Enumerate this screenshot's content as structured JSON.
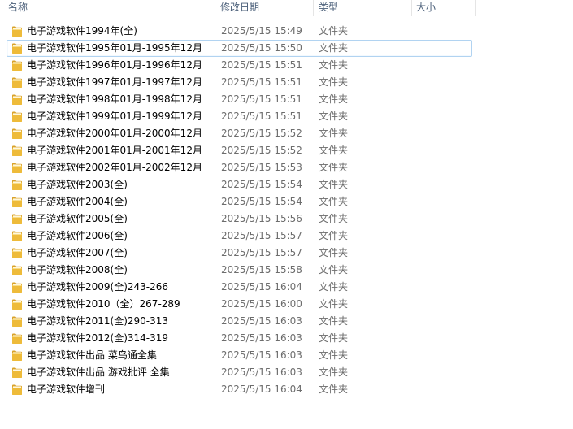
{
  "columns": {
    "name": "名称",
    "date": "修改日期",
    "type": "类型",
    "size": "大小"
  },
  "colors": {
    "header_text": "#4c607a",
    "meta_text": "#6d6d6d",
    "selection_border": "#b1d3f1",
    "folder": "#e8b53a"
  },
  "selected_index": 1,
  "files": [
    {
      "icon": "folder-icon",
      "name": "电子游戏软件1994年(全)",
      "date": "2025/5/15 15:49",
      "type": "文件夹"
    },
    {
      "icon": "folder-icon",
      "name": "电子游戏软件1995年01月-1995年12月",
      "date": "2025/5/15 15:50",
      "type": "文件夹"
    },
    {
      "icon": "folder-icon",
      "name": "电子游戏软件1996年01月-1996年12月",
      "date": "2025/5/15 15:51",
      "type": "文件夹"
    },
    {
      "icon": "folder-icon",
      "name": "电子游戏软件1997年01月-1997年12月",
      "date": "2025/5/15 15:51",
      "type": "文件夹"
    },
    {
      "icon": "folder-icon",
      "name": "电子游戏软件1998年01月-1998年12月",
      "date": "2025/5/15 15:51",
      "type": "文件夹"
    },
    {
      "icon": "folder-icon",
      "name": "电子游戏软件1999年01月-1999年12月",
      "date": "2025/5/15 15:51",
      "type": "文件夹"
    },
    {
      "icon": "folder-icon",
      "name": "电子游戏软件2000年01月-2000年12月",
      "date": "2025/5/15 15:52",
      "type": "文件夹"
    },
    {
      "icon": "folder-icon",
      "name": "电子游戏软件2001年01月-2001年12月",
      "date": "2025/5/15 15:52",
      "type": "文件夹"
    },
    {
      "icon": "folder-icon",
      "name": "电子游戏软件2002年01月-2002年12月",
      "date": "2025/5/15 15:53",
      "type": "文件夹"
    },
    {
      "icon": "folder-icon",
      "name": "电子游戏软件2003(全)",
      "date": "2025/5/15 15:54",
      "type": "文件夹"
    },
    {
      "icon": "folder-icon",
      "name": "电子游戏软件2004(全)",
      "date": "2025/5/15 15:54",
      "type": "文件夹"
    },
    {
      "icon": "folder-icon",
      "name": "电子游戏软件2005(全)",
      "date": "2025/5/15 15:56",
      "type": "文件夹"
    },
    {
      "icon": "folder-icon",
      "name": "电子游戏软件2006(全)",
      "date": "2025/5/15 15:57",
      "type": "文件夹"
    },
    {
      "icon": "folder-icon",
      "name": "电子游戏软件2007(全)",
      "date": "2025/5/15 15:57",
      "type": "文件夹"
    },
    {
      "icon": "folder-icon",
      "name": "电子游戏软件2008(全)",
      "date": "2025/5/15 15:58",
      "type": "文件夹"
    },
    {
      "icon": "folder-icon",
      "name": "电子游戏软件2009(全)243-266",
      "date": "2025/5/15 16:04",
      "type": "文件夹"
    },
    {
      "icon": "folder-icon",
      "name": "电子游戏软件2010（全）267-289",
      "date": "2025/5/15 16:00",
      "type": "文件夹"
    },
    {
      "icon": "folder-icon",
      "name": "电子游戏软件2011(全)290-313",
      "date": "2025/5/15 16:03",
      "type": "文件夹"
    },
    {
      "icon": "folder-icon",
      "name": "电子游戏软件2012(全)314-319",
      "date": "2025/5/15 16:03",
      "type": "文件夹"
    },
    {
      "icon": "folder-icon",
      "name": "电子游戏软件出品 菜鸟通全集",
      "date": "2025/5/15 16:03",
      "type": "文件夹"
    },
    {
      "icon": "folder-icon",
      "name": "电子游戏软件出品 游戏批评 全集",
      "date": "2025/5/15 16:03",
      "type": "文件夹"
    },
    {
      "icon": "folder-icon",
      "name": "电子游戏软件增刊",
      "date": "2025/5/15 16:04",
      "type": "文件夹"
    }
  ]
}
